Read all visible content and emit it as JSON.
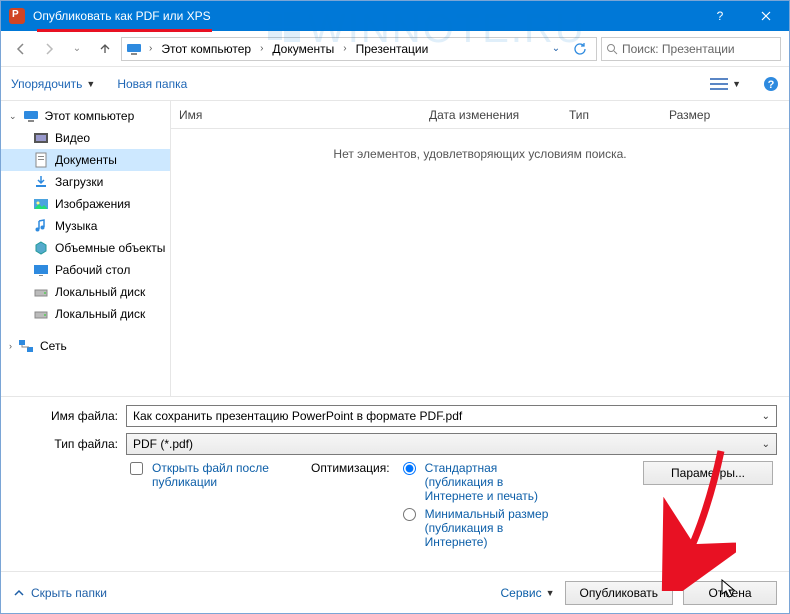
{
  "title": "Опубликовать как PDF или XPS",
  "watermark": "WINNOTE.RU",
  "breadcrumb": {
    "root_icon": "pc",
    "items": [
      "Этот компьютер",
      "Документы",
      "Презентации"
    ]
  },
  "search": {
    "placeholder": "Поиск: Презентации"
  },
  "toolbar": {
    "organize": "Упорядочить",
    "new_folder": "Новая папка"
  },
  "columns": {
    "name": "Имя",
    "modified": "Дата изменения",
    "type": "Тип",
    "size": "Размер"
  },
  "empty_msg": "Нет элементов, удовлетворяющих условиям поиска.",
  "sidebar": {
    "root": "Этот компьютер",
    "items": [
      {
        "label": "Видео",
        "icon": "video"
      },
      {
        "label": "Документы",
        "icon": "doc",
        "selected": true
      },
      {
        "label": "Загрузки",
        "icon": "download"
      },
      {
        "label": "Изображения",
        "icon": "image"
      },
      {
        "label": "Музыка",
        "icon": "music"
      },
      {
        "label": "Объемные объекты",
        "icon": "3d"
      },
      {
        "label": "Рабочий стол",
        "icon": "desktop"
      },
      {
        "label": "Локальный диск",
        "icon": "drive"
      },
      {
        "label": "Локальный диск",
        "icon": "drive"
      }
    ],
    "network": "Сеть"
  },
  "filename_label": "Имя файла:",
  "filename_value": "Как сохранить презентацию PowerPoint в формате PDF.pdf",
  "filetype_label": "Тип файла:",
  "filetype_value": "PDF (*.pdf)",
  "open_after": "Открыть файл после публикации",
  "optimization_label": "Оптимизация:",
  "opt_standard": "Стандартная (публикация в Интернете и печать)",
  "opt_minimal": "Минимальный размер (публикация в Интернете)",
  "params_btn": "Параметры...",
  "hide_folders": "Скрыть папки",
  "service": "Сервис",
  "publish": "Опубликовать",
  "cancel": "Отмена"
}
